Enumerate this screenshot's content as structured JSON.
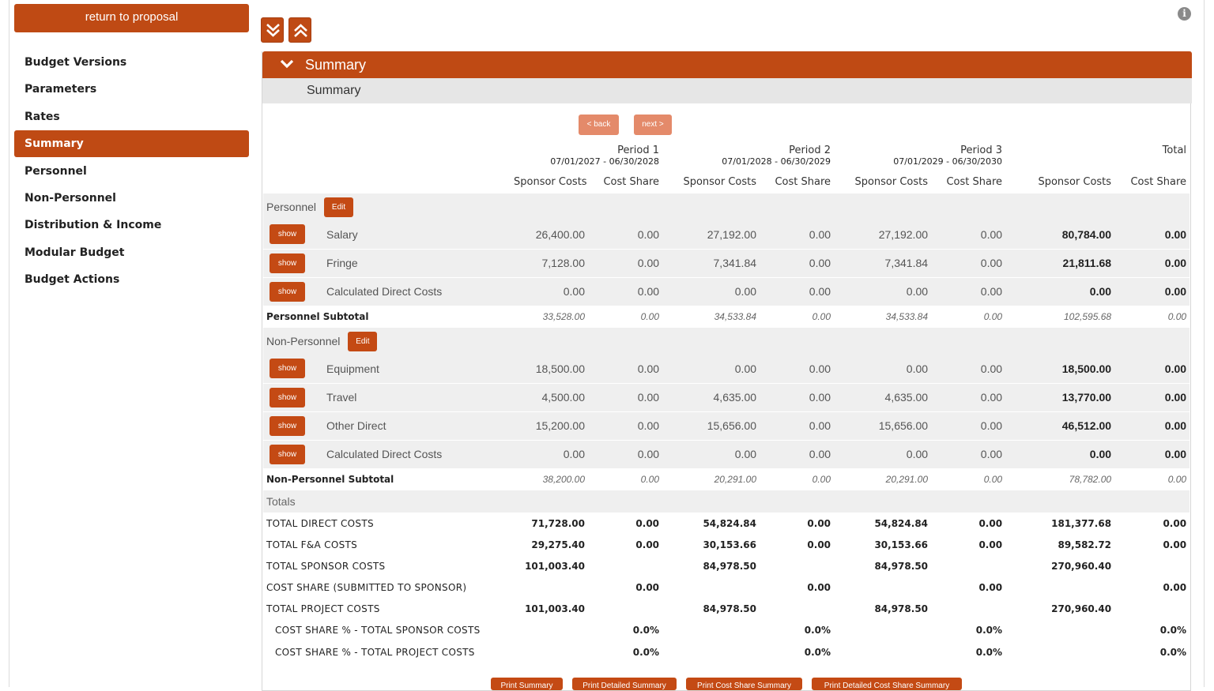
{
  "sidebar": {
    "return_label": "return to proposal",
    "items": [
      {
        "label": "Budget Versions"
      },
      {
        "label": "Parameters"
      },
      {
        "label": "Rates"
      },
      {
        "label": "Summary",
        "active": true
      },
      {
        "label": "Personnel"
      },
      {
        "label": "Non-Personnel"
      },
      {
        "label": "Distribution & Income"
      },
      {
        "label": "Modular Budget"
      },
      {
        "label": "Budget Actions"
      }
    ]
  },
  "toolbar": {
    "expand_all_icon": "double-chevron-down-icon",
    "collapse_all_icon": "double-chevron-up-icon",
    "info_icon": "info-icon",
    "info_glyph": "i"
  },
  "panel": {
    "header_title": "Summary",
    "sub_title": "Summary",
    "back_label": "< back",
    "next_label": "next >"
  },
  "columns": {
    "periods": [
      {
        "name": "Period 1",
        "dates": "07/01/2027 - 06/30/2028"
      },
      {
        "name": "Period 2",
        "dates": "07/01/2028 - 06/30/2029"
      },
      {
        "name": "Period 3",
        "dates": "07/01/2029 - 06/30/2030"
      }
    ],
    "total_label": "Total",
    "sponsor_costs": "Sponsor Costs",
    "cost_share": "Cost Share"
  },
  "personnel": {
    "label": "Personnel",
    "edit_label": "Edit",
    "rows": [
      {
        "show": "show",
        "label": "Salary",
        "values": [
          "26,400.00",
          "0.00",
          "27,192.00",
          "0.00",
          "27,192.00",
          "0.00",
          "80,784.00",
          "0.00"
        ]
      },
      {
        "show": "show",
        "label": "Fringe",
        "values": [
          "7,128.00",
          "0.00",
          "7,341.84",
          "0.00",
          "7,341.84",
          "0.00",
          "21,811.68",
          "0.00"
        ]
      },
      {
        "show": "show",
        "label": "Calculated Direct Costs",
        "values": [
          "0.00",
          "0.00",
          "0.00",
          "0.00",
          "0.00",
          "0.00",
          "0.00",
          "0.00"
        ]
      }
    ],
    "subtotal_label": "Personnel Subtotal",
    "subtotal": [
      "33,528.00",
      "0.00",
      "34,533.84",
      "0.00",
      "34,533.84",
      "0.00",
      "102,595.68",
      "0.00"
    ]
  },
  "non_personnel": {
    "label": "Non-Personnel",
    "edit_label": "Edit",
    "rows": [
      {
        "show": "show",
        "label": "Equipment",
        "values": [
          "18,500.00",
          "0.00",
          "0.00",
          "0.00",
          "0.00",
          "0.00",
          "18,500.00",
          "0.00"
        ]
      },
      {
        "show": "show",
        "label": "Travel",
        "values": [
          "4,500.00",
          "0.00",
          "4,635.00",
          "0.00",
          "4,635.00",
          "0.00",
          "13,770.00",
          "0.00"
        ]
      },
      {
        "show": "show",
        "label": "Other Direct",
        "values": [
          "15,200.00",
          "0.00",
          "15,656.00",
          "0.00",
          "15,656.00",
          "0.00",
          "46,512.00",
          "0.00"
        ]
      },
      {
        "show": "show",
        "label": "Calculated Direct Costs",
        "values": [
          "0.00",
          "0.00",
          "0.00",
          "0.00",
          "0.00",
          "0.00",
          "0.00",
          "0.00"
        ]
      }
    ],
    "subtotal_label": "Non-Personnel Subtotal",
    "subtotal": [
      "38,200.00",
      "0.00",
      "20,291.00",
      "0.00",
      "20,291.00",
      "0.00",
      "78,782.00",
      "0.00"
    ]
  },
  "totals": {
    "label": "Totals",
    "rows": [
      {
        "label": "TOTAL DIRECT COSTS",
        "values": [
          "71,728.00",
          "0.00",
          "54,824.84",
          "0.00",
          "54,824.84",
          "0.00",
          "181,377.68",
          "0.00"
        ]
      },
      {
        "label": "TOTAL F&A COSTS",
        "values": [
          "29,275.40",
          "0.00",
          "30,153.66",
          "0.00",
          "30,153.66",
          "0.00",
          "89,582.72",
          "0.00"
        ]
      },
      {
        "label": "TOTAL SPONSOR COSTS",
        "values": [
          "101,003.40",
          "",
          "84,978.50",
          "",
          "84,978.50",
          "",
          "270,960.40",
          ""
        ]
      },
      {
        "label": "COST SHARE (SUBMITTED TO SPONSOR)",
        "values": [
          "",
          "0.00",
          "",
          "0.00",
          "",
          "0.00",
          "",
          "0.00"
        ]
      },
      {
        "label": "TOTAL PROJECT COSTS",
        "values": [
          "101,003.40",
          "",
          "84,978.50",
          "",
          "84,978.50",
          "",
          "270,960.40",
          ""
        ]
      },
      {
        "label": "COST SHARE % - TOTAL SPONSOR COSTS",
        "indent": true,
        "values": [
          "",
          "0.0%",
          "",
          "0.0%",
          "",
          "0.0%",
          "",
          "0.0%"
        ]
      },
      {
        "label": "COST SHARE % - TOTAL PROJECT COSTS",
        "indent": true,
        "values": [
          "",
          "0.0%",
          "",
          "0.0%",
          "",
          "0.0%",
          "",
          "0.0%"
        ]
      }
    ]
  },
  "print_buttons": [
    {
      "label": "Print Summary"
    },
    {
      "label": "Print Detailed Summary"
    },
    {
      "label": "Print Cost Share Summary"
    },
    {
      "label": "Print Detailed Cost Share Summary"
    }
  ],
  "colors": {
    "accent": "#bf4a14",
    "accent_light": "#e48a6a",
    "row_bg": "#efefef",
    "subheader_bg": "#e6e6e6"
  }
}
